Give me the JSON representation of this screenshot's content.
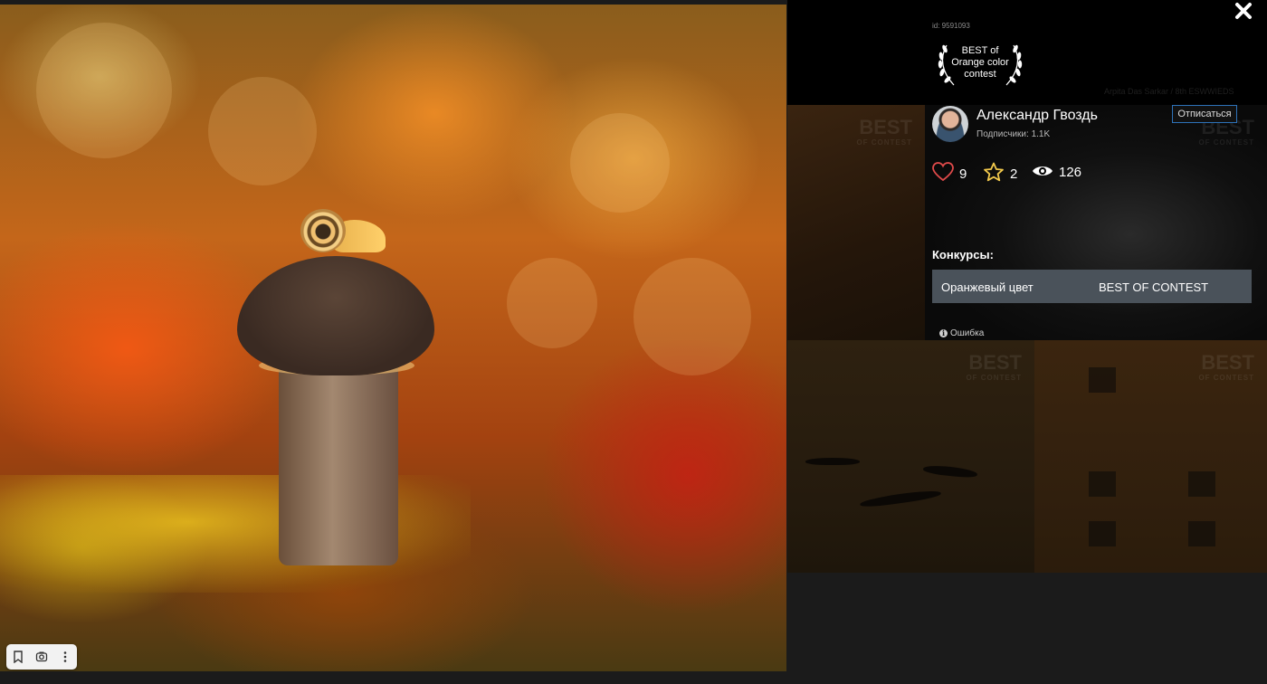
{
  "photo": {
    "alt": "Snail on a mushroom"
  },
  "info": {
    "photo_id": "id: 9591093",
    "badge_lines": [
      "BEST of",
      "Orange color",
      "contest"
    ],
    "credit": "Arpita Das Sarkar / 8th ESWWIEDS"
  },
  "author": {
    "name": "Александр Гвоздь",
    "subscribers": "Подписчики: 1.1K",
    "unsubscribe_label": "Отписаться"
  },
  "stats": {
    "likes": "9",
    "favorites": "2",
    "views": "126"
  },
  "contests": {
    "label": "Конкурсы:",
    "rows": [
      {
        "name": "Оранжевый цвет",
        "award": "BEST OF CONTEST"
      }
    ]
  },
  "error_link": "Ошибка",
  "background_tiles": {
    "watermark_title": "BEST",
    "watermark_sub": "OF CONTEST"
  },
  "icons": {
    "close": "close-icon",
    "heart": "heart-icon",
    "star": "star-icon",
    "eye": "eye-icon",
    "bookmark": "bookmark-icon",
    "lens": "visual-search-icon",
    "more": "more-vertical-icon"
  },
  "colors": {
    "like": "#e04a4a",
    "favorite": "#f2c94c",
    "accent_border": "#2d72b8",
    "contest_row_bg": "#4a525a"
  }
}
